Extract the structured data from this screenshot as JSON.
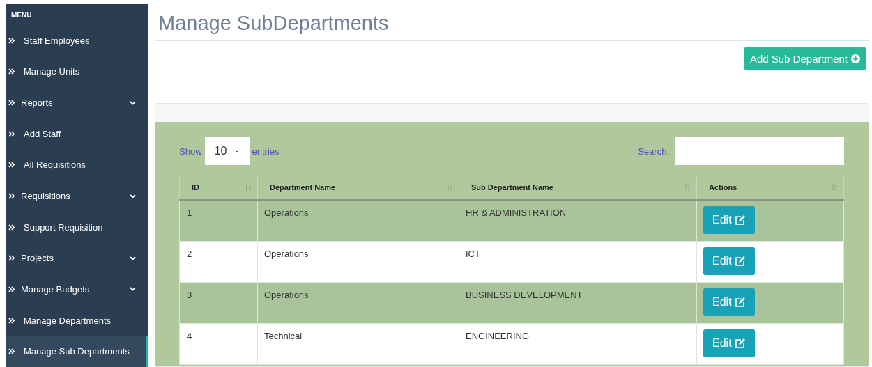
{
  "sidebar": {
    "heading": "MENU",
    "items": [
      {
        "label": "Staff Employees",
        "expandable": false,
        "selected": false
      },
      {
        "label": "Manage Units",
        "expandable": false,
        "selected": false
      },
      {
        "label": "Reports",
        "expandable": true,
        "selected": false
      },
      {
        "label": "Add Staff",
        "expandable": false,
        "selected": false
      },
      {
        "label": "All Requisitions",
        "expandable": false,
        "selected": false
      },
      {
        "label": "Requisitions",
        "expandable": true,
        "selected": false
      },
      {
        "label": "Support Requisition",
        "expandable": false,
        "selected": false
      },
      {
        "label": "Projects",
        "expandable": true,
        "selected": false
      },
      {
        "label": "Manage Budgets",
        "expandable": true,
        "selected": false
      },
      {
        "label": "Manage Departments",
        "expandable": false,
        "selected": false
      },
      {
        "label": "Manage Sub Departments",
        "expandable": false,
        "selected": true
      }
    ]
  },
  "page": {
    "title": "Manage SubDepartments",
    "add_button": "Add Sub Department"
  },
  "table_controls": {
    "show_label": "Show",
    "page_size": "10",
    "entries_label": "entries",
    "search_label": "Search:"
  },
  "table": {
    "columns": [
      {
        "label": "ID",
        "sorted": true
      },
      {
        "label": "Department Name",
        "sorted": false
      },
      {
        "label": "Sub Department Name",
        "sorted": false
      },
      {
        "label": "Actions",
        "sorted": false
      }
    ],
    "rows": [
      {
        "id": "1",
        "department": "Operations",
        "sub_department": "HR & ADMINISTRATION",
        "action": "Edit"
      },
      {
        "id": "2",
        "department": "Operations",
        "sub_department": "ICT",
        "action": "Edit"
      },
      {
        "id": "3",
        "department": "Operations",
        "sub_department": "BUSINESS DEVELOPMENT",
        "action": "Edit"
      },
      {
        "id": "4",
        "department": "Technical",
        "sub_department": "ENGINEERING",
        "action": "Edit"
      }
    ]
  }
}
